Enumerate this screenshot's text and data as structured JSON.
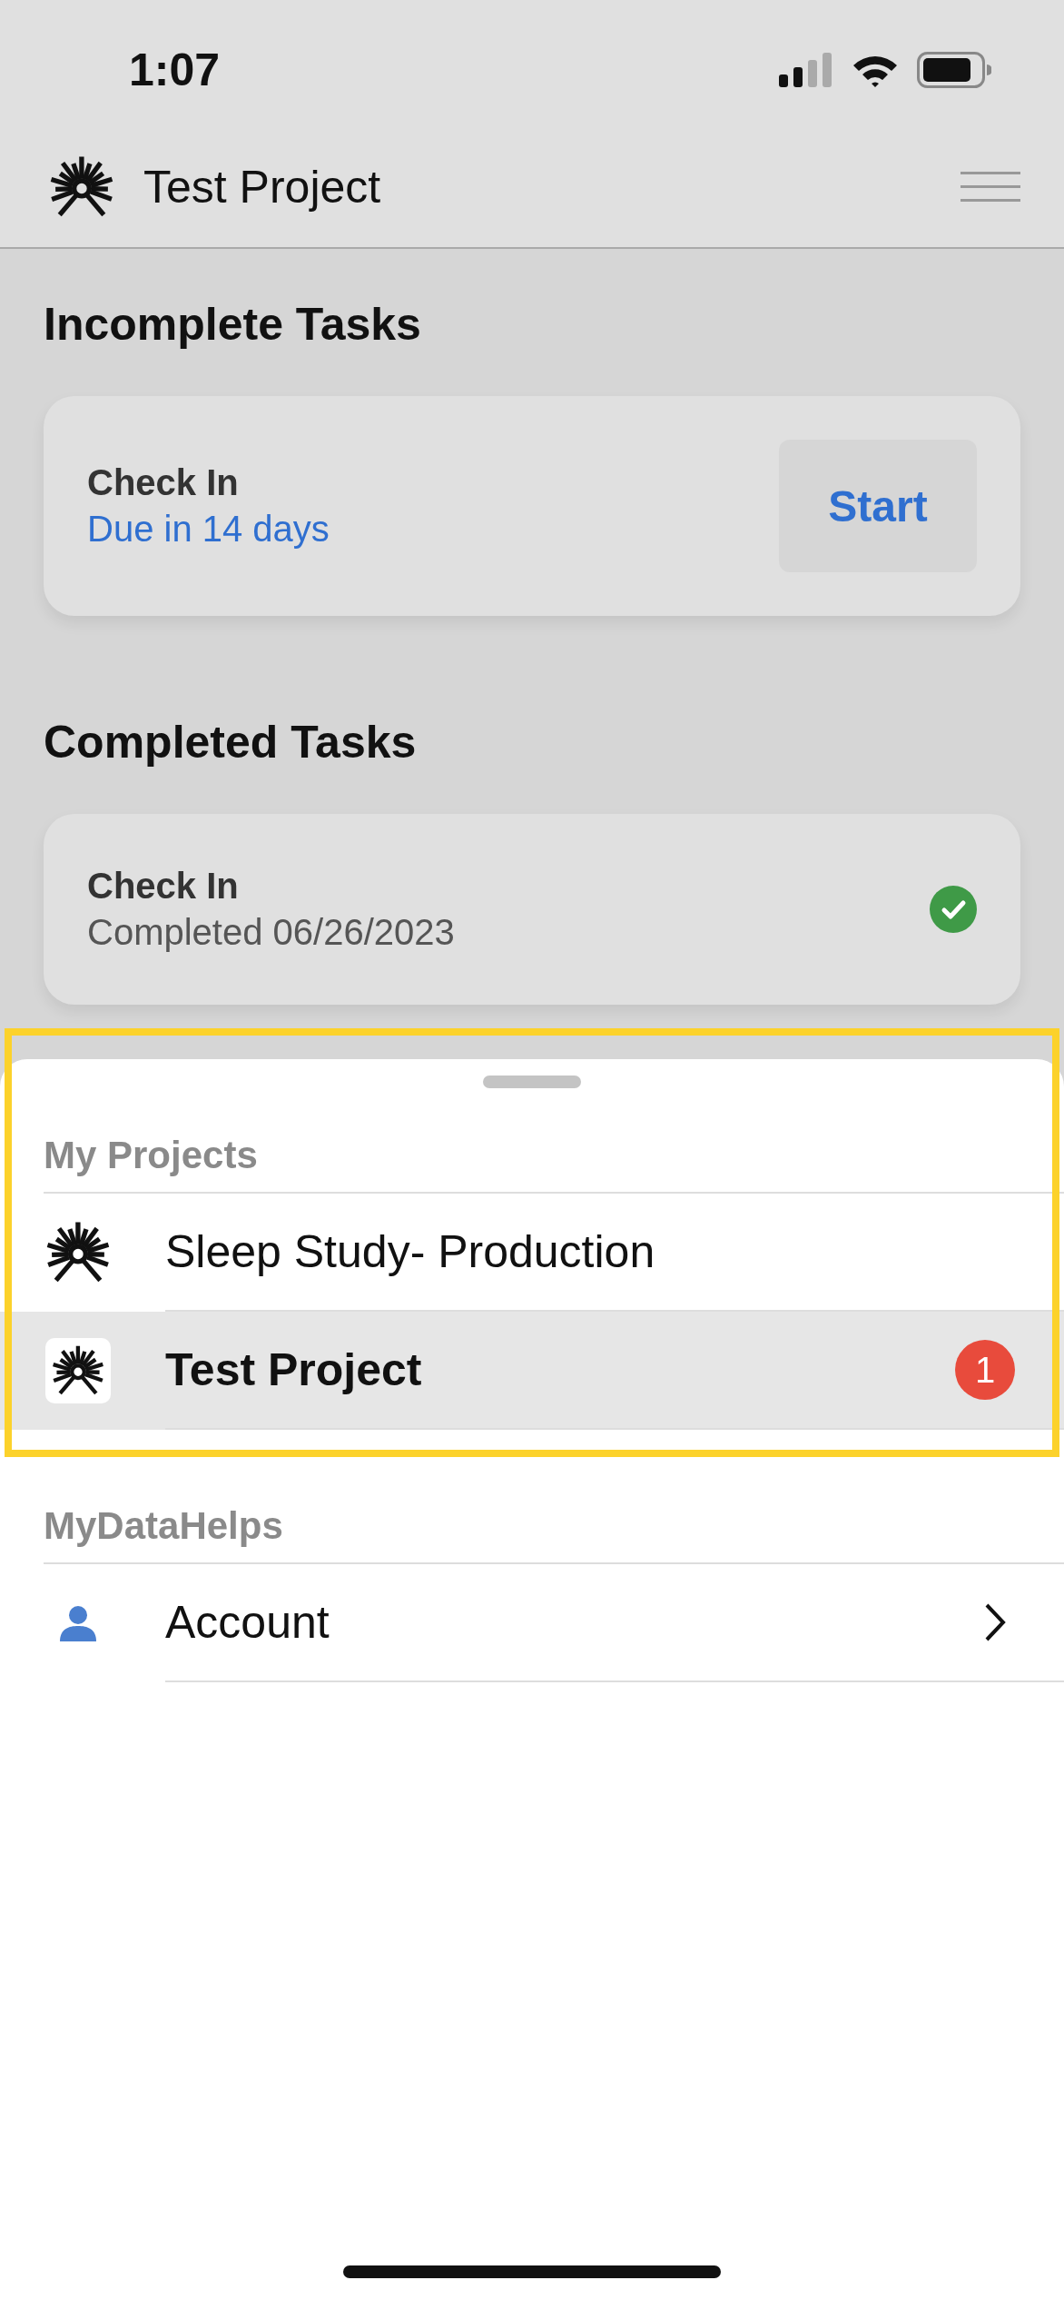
{
  "status_bar": {
    "time": "1:07"
  },
  "header": {
    "title": "Test Project"
  },
  "incomplete_tasks": {
    "heading": "Incomplete Tasks",
    "tasks": [
      {
        "title": "Check In",
        "due": "Due in 14 days",
        "button": "Start"
      }
    ]
  },
  "completed_tasks": {
    "heading": "Completed Tasks",
    "tasks": [
      {
        "title": "Check In",
        "completed": "Completed 06/26/2023",
        "done": true
      }
    ]
  },
  "sheet": {
    "sections": [
      {
        "heading": "My Projects",
        "highlighted": true,
        "items": [
          {
            "kind": "project",
            "label": "Sleep Study- Production",
            "selected": false
          },
          {
            "kind": "project",
            "label": "Test Project",
            "selected": true,
            "badge": "1"
          }
        ]
      },
      {
        "heading": "MyDataHelps",
        "highlighted": false,
        "items": [
          {
            "kind": "account",
            "label": "Account",
            "selected": false
          }
        ]
      }
    ]
  }
}
